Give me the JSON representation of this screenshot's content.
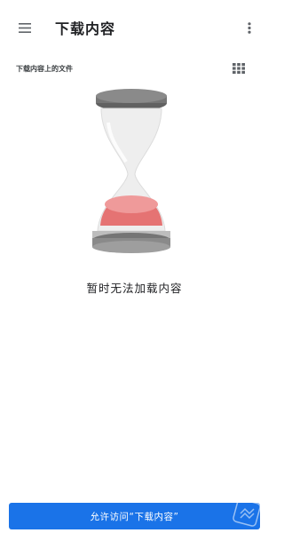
{
  "app_bar": {
    "title": "下载内容",
    "menu_icon": "hamburger-menu-icon",
    "more_icon": "more-vert-icon"
  },
  "subheader": {
    "label": "下载内容上的文件",
    "view_icon": "grid-view-icon"
  },
  "empty_state": {
    "illustration": "hourglass-icon",
    "message": "暂时无法加载内容"
  },
  "footer": {
    "allow_button_label": "允许访问“下载内容”"
  },
  "colors": {
    "accent": "#1a73e8",
    "sand": "#e57373",
    "cap": "#757575"
  }
}
